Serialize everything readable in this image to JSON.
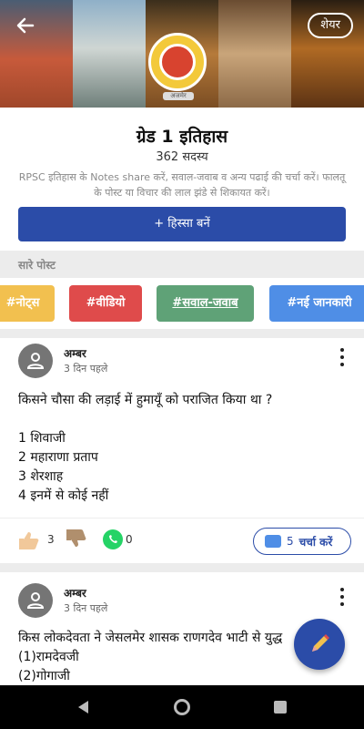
{
  "header": {
    "share_label": "शेयर",
    "logo_caption": "अजमेर"
  },
  "group": {
    "title": "ग्रेड 1 इतिहास",
    "members": "362 सदस्य",
    "description": "RPSC इतिहास के Notes share करें, सवाल-जवाब व अन्य पढाई की चर्चा करें। फालतू के पोस्ट या विचार की लाल झंडे से शिकायत करें।",
    "join_label": "+ हिस्सा बनें"
  },
  "section": {
    "label": "सारे पोस्ट"
  },
  "tags": [
    {
      "label": "#नोट्स",
      "color": "#f2c04f"
    },
    {
      "label": "#वीडियो",
      "color": "#df4b4b"
    },
    {
      "label": "#सवाल-जवाब",
      "color": "#5fa277"
    },
    {
      "label": "#नई जानकारी",
      "color": "#4f8ee6"
    }
  ],
  "posts": [
    {
      "author": "अम्बर",
      "time": "3 दिन पहले",
      "lines": [
        "किसने चौसा की लड़ाई में हुमायूँ को पराजित किया था ?",
        "",
        "1 शिवाजी",
        "2 महाराणा प्रताप",
        "3 शेरशाह",
        "4 इनमें से कोई नहीं"
      ],
      "likes": "3",
      "whatsapp_count": "0",
      "discuss_count": "5",
      "discuss_label": "चर्चा करें"
    },
    {
      "author": "अम्बर",
      "time": "3 दिन पहले",
      "lines": [
        "किस लोकदेवता ने जेसलमेर शासक राणगदेव भाटी से युद्ध",
        "(1)रामदेवजी",
        "(2)गोगाजी"
      ]
    }
  ],
  "colors": {
    "accent": "#2b4ca8",
    "whatsapp": "#25d366"
  }
}
